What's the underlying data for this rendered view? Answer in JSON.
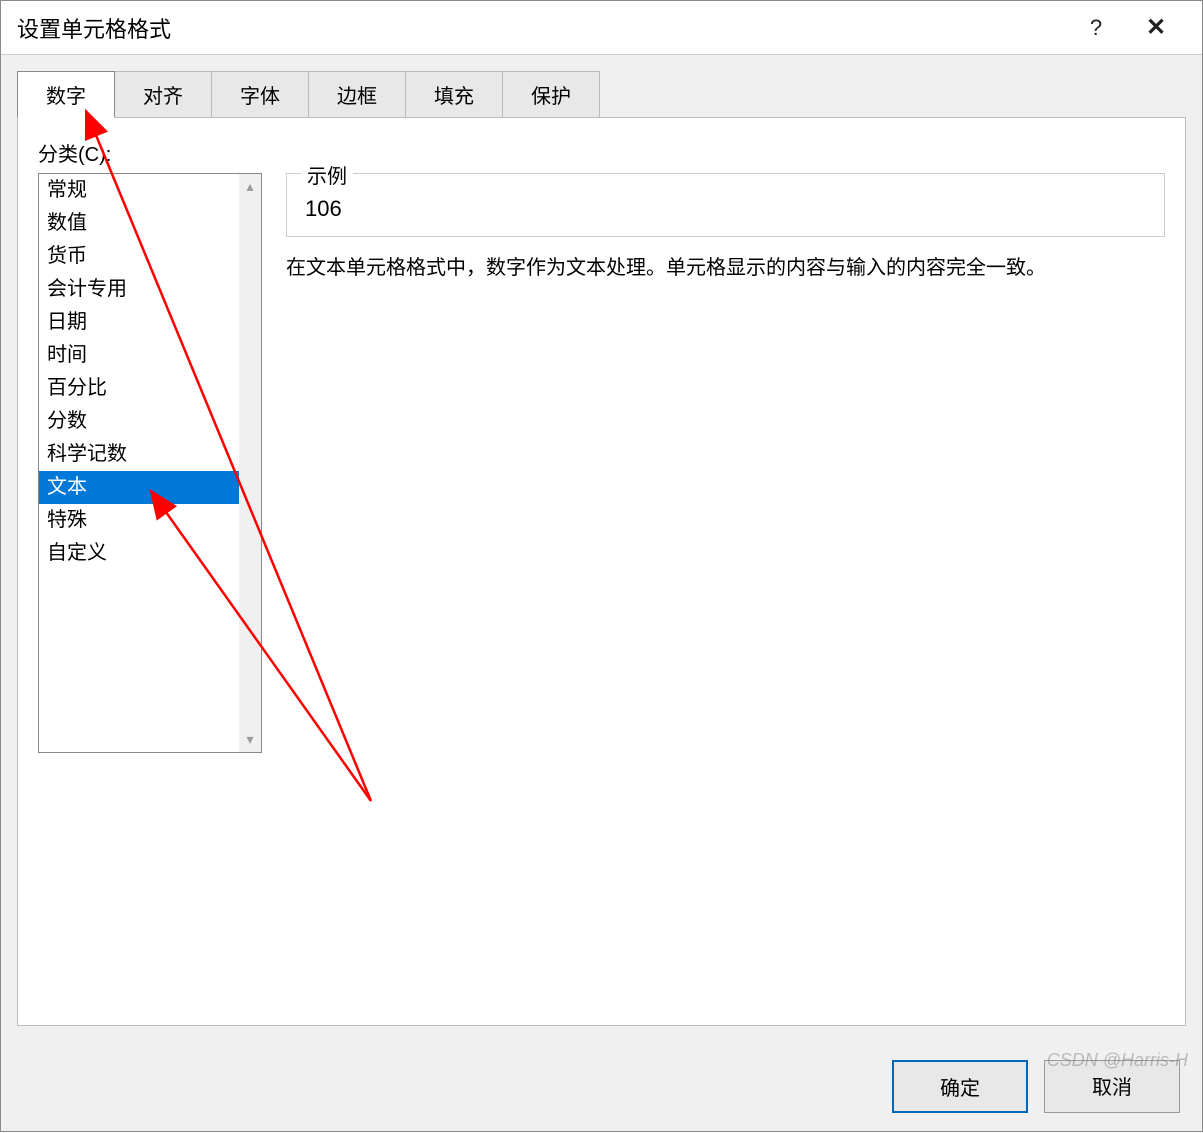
{
  "dialog": {
    "title": "设置单元格格式",
    "help_icon": "?",
    "close_icon": "✕"
  },
  "tabs": [
    {
      "label": "数字",
      "active": true
    },
    {
      "label": "对齐",
      "active": false
    },
    {
      "label": "字体",
      "active": false
    },
    {
      "label": "边框",
      "active": false
    },
    {
      "label": "填充",
      "active": false
    },
    {
      "label": "保护",
      "active": false
    }
  ],
  "category": {
    "label": "分类(C):",
    "items": [
      {
        "label": "常规",
        "selected": false
      },
      {
        "label": "数值",
        "selected": false
      },
      {
        "label": "货币",
        "selected": false
      },
      {
        "label": "会计专用",
        "selected": false
      },
      {
        "label": "日期",
        "selected": false
      },
      {
        "label": "时间",
        "selected": false
      },
      {
        "label": "百分比",
        "selected": false
      },
      {
        "label": "分数",
        "selected": false
      },
      {
        "label": "科学记数",
        "selected": false
      },
      {
        "label": "文本",
        "selected": true
      },
      {
        "label": "特殊",
        "selected": false
      },
      {
        "label": "自定义",
        "selected": false
      }
    ]
  },
  "sample": {
    "label": "示例",
    "value": "106"
  },
  "description": "在文本单元格格式中，数字作为文本处理。单元格显示的内容与输入的内容完全一致。",
  "buttons": {
    "ok": "确定",
    "cancel": "取消"
  },
  "watermark": "CSDN @Harris-H",
  "colors": {
    "selection": "#0078d7",
    "arrow": "#ff0000"
  }
}
